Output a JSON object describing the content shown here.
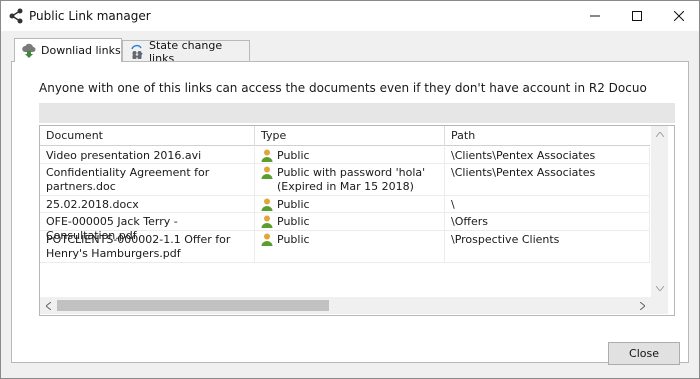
{
  "window": {
    "title": "Public Link manager",
    "icon": "share-icon"
  },
  "tabs": [
    {
      "label": "Downliad links",
      "icon": "download-cloud-icon",
      "active": true
    },
    {
      "label": "State change links",
      "icon": "users-sync-icon",
      "active": false
    }
  ],
  "info_text": "Anyone with one of this links can access the documents even if they don't have account in R2 Docuo",
  "table": {
    "columns": [
      "Document",
      "Type",
      "Path"
    ],
    "rows": [
      {
        "document": "Video presentation 2016.avi",
        "type": "Public",
        "path": "\\Clients\\Pentex Associates"
      },
      {
        "document": "Confidentiality Agreement for partners.doc",
        "type": "Public with password 'hola' (Expired in Mar 15 2018)",
        "path": "\\Clients\\Pentex Associates"
      },
      {
        "document": "25.02.2018.docx",
        "type": "Public",
        "path": "\\"
      },
      {
        "document": "OFE-000005 Jack Terry - Consultation.pdf",
        "type": "Public",
        "path": "\\Offers"
      },
      {
        "document": "POTCLIENTS-000002-1.1 Offer for Henry's Hamburgers.pdf",
        "type": "Public",
        "path": "\\Prospective Clients"
      }
    ]
  },
  "buttons": {
    "close_label": "Close"
  },
  "colors": {
    "user_icon_body": "#5a9e2f",
    "user_icon_head": "#e3a43a",
    "download_icon": "#3c8a3a"
  }
}
